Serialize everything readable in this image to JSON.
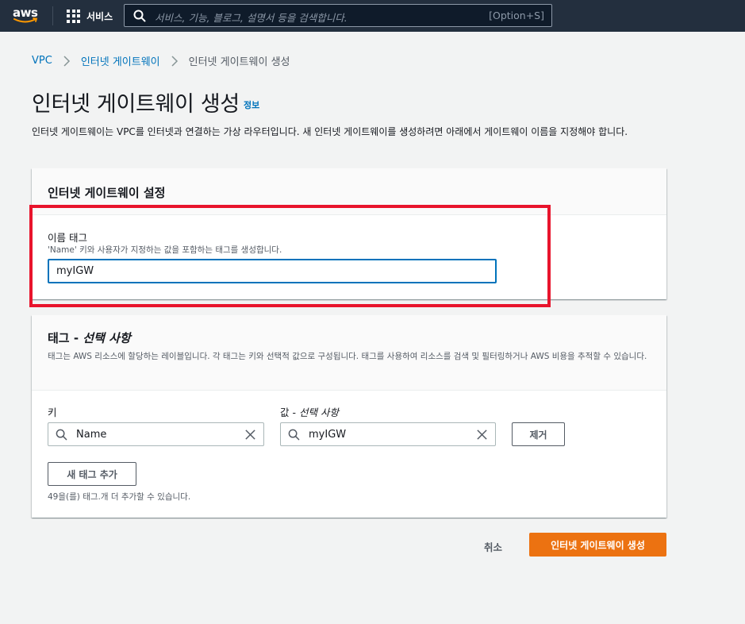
{
  "nav": {
    "logo_text": "aws",
    "services_label": "서비스",
    "search_placeholder": "서비스, 기능, 블로그, 설명서 등을 검색합니다.",
    "search_shortcut": "[Option+S]"
  },
  "breadcrumb": {
    "items": [
      "VPC",
      "인터넷 게이트웨이"
    ],
    "current": "인터넷 게이트웨이 생성"
  },
  "page": {
    "title": "인터넷 게이트웨이 생성",
    "info_link": "정보",
    "description": "인터넷 게이트웨이는 VPC를 인터넷과 연결하는 가상 라우터입니다. 새 인터넷 게이트웨이를 생성하려면 아래에서 게이트웨이 이름을 지정해야 합니다."
  },
  "settings_panel": {
    "title": "인터넷 게이트웨이 설정",
    "name_label": "이름 태그",
    "name_hint": "'Name' 키와 사용자가 지정하는 값을 포함하는 태그를 생성합니다.",
    "name_value": "myIGW"
  },
  "tags_panel": {
    "title_prefix": "태그 - ",
    "title_optional": "선택 사항",
    "description": "태그는 AWS 리소스에 할당하는 레이블입니다. 각 태그는 키와 선택적 값으로 구성됩니다. 태그를 사용하여 리소스를 검색 및 필터링하거나 AWS 비용을 추적할 수 있습니다.",
    "key_label": "키",
    "value_label_prefix": "값 - ",
    "value_label_optional": "선택 사항",
    "key_value": "Name",
    "value_value": "myIGW",
    "remove_button": "제거",
    "add_button": "새 태그 추가",
    "limit_text": "49을(를) 태그.개 더 추가할 수 있습니다."
  },
  "footer": {
    "cancel_label": "취소",
    "create_label": "인터넷 게이트웨이 생성"
  },
  "colors": {
    "nav_bg": "#232f3e",
    "link": "#0073bb",
    "primary": "#ec7211",
    "highlight": "#e8142c"
  }
}
